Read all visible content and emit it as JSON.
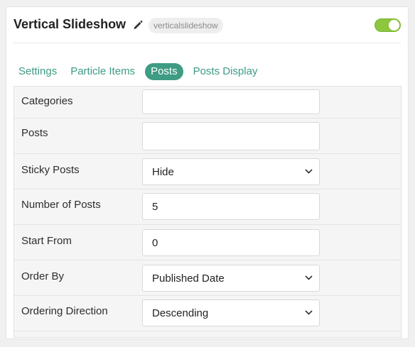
{
  "header": {
    "title": "Vertical Slideshow",
    "slug": "verticalslideshow",
    "enabled": true
  },
  "tabs": [
    {
      "label": "Settings",
      "active": false
    },
    {
      "label": "Particle Items",
      "active": false
    },
    {
      "label": "Posts",
      "active": true
    },
    {
      "label": "Posts Display",
      "active": false
    }
  ],
  "form": {
    "categories": {
      "label": "Categories",
      "value": ""
    },
    "posts": {
      "label": "Posts",
      "value": ""
    },
    "sticky_posts": {
      "label": "Sticky Posts",
      "value": "Hide"
    },
    "number_of_posts": {
      "label": "Number of Posts",
      "value": "5"
    },
    "start_from": {
      "label": "Start From",
      "value": "0"
    },
    "order_by": {
      "label": "Order By",
      "value": "Published Date"
    },
    "ordering_direction": {
      "label": "Ordering Direction",
      "value": "Descending"
    }
  },
  "colors": {
    "accent": "#3e9b84",
    "toggle_on": "#8dc63f"
  }
}
